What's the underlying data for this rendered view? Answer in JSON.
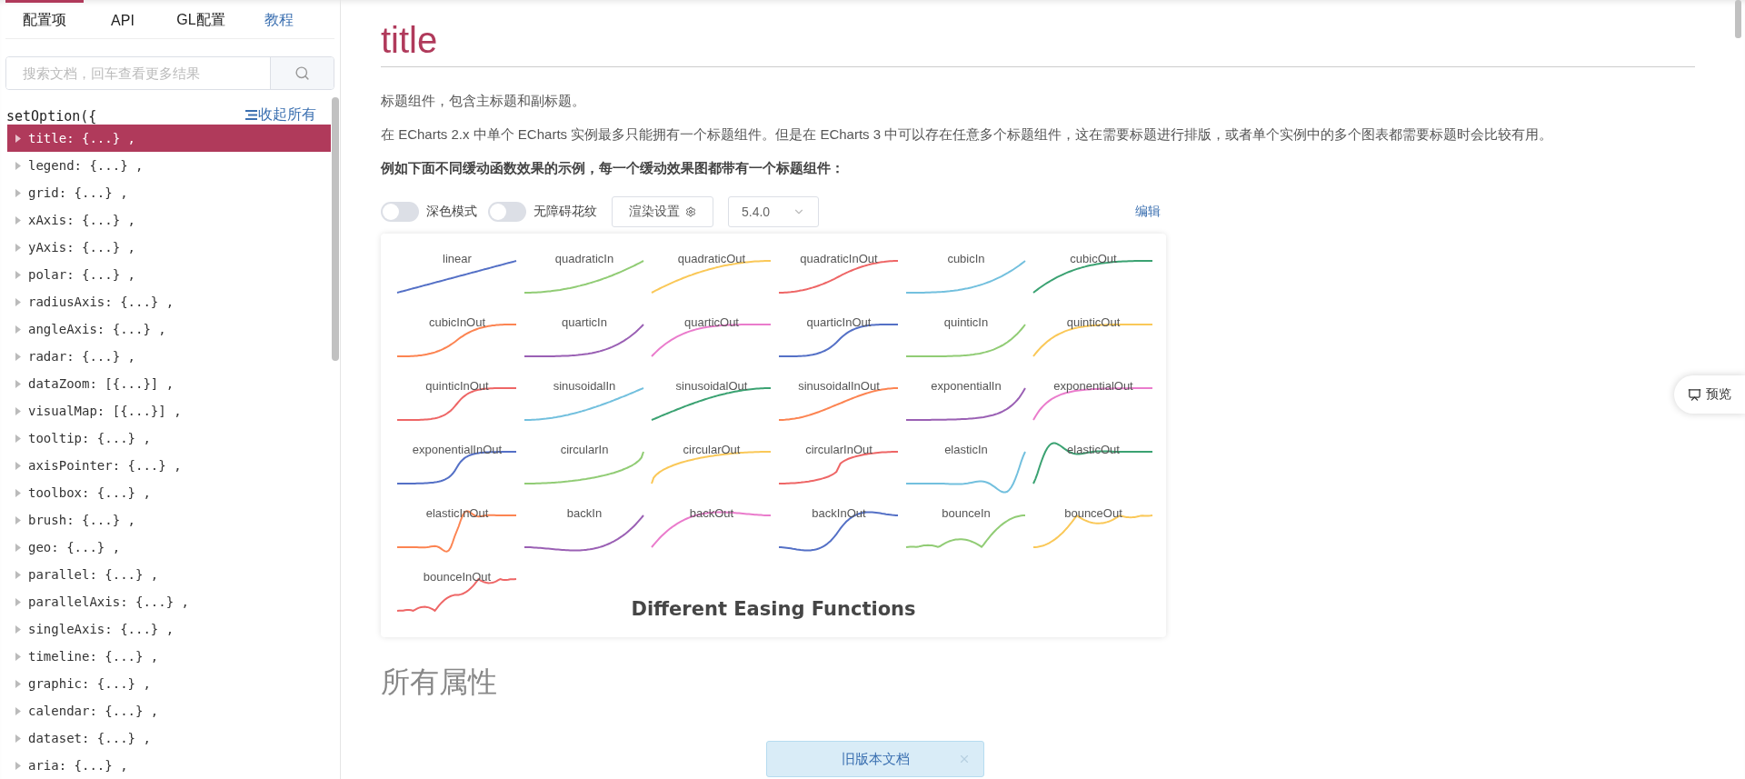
{
  "sidebar": {
    "tabs": [
      {
        "label": "配置项",
        "kind": "tab",
        "selected": true
      },
      {
        "label": "API",
        "kind": "tab",
        "selected": false
      },
      {
        "label": "GL配置",
        "kind": "tab",
        "selected": false
      },
      {
        "label": "教程",
        "kind": "link",
        "selected": false
      }
    ],
    "search": {
      "placeholder": "搜索文档，回车查看更多结果"
    },
    "tree_header": "setOption({",
    "collapse_all": "收起所有",
    "items": [
      {
        "label": "title: {...} ,",
        "selected": true
      },
      {
        "label": "legend: {...} ,",
        "selected": false
      },
      {
        "label": "grid: {...} ,",
        "selected": false
      },
      {
        "label": "xAxis: {...} ,",
        "selected": false
      },
      {
        "label": "yAxis: {...} ,",
        "selected": false
      },
      {
        "label": "polar: {...} ,",
        "selected": false
      },
      {
        "label": "radiusAxis: {...} ,",
        "selected": false
      },
      {
        "label": "angleAxis: {...} ,",
        "selected": false
      },
      {
        "label": "radar: {...} ,",
        "selected": false
      },
      {
        "label": "dataZoom: [{...}] ,",
        "selected": false
      },
      {
        "label": "visualMap: [{...}] ,",
        "selected": false
      },
      {
        "label": "tooltip: {...} ,",
        "selected": false
      },
      {
        "label": "axisPointer: {...} ,",
        "selected": false
      },
      {
        "label": "toolbox: {...} ,",
        "selected": false
      },
      {
        "label": "brush: {...} ,",
        "selected": false
      },
      {
        "label": "geo: {...} ,",
        "selected": false
      },
      {
        "label": "parallel: {...} ,",
        "selected": false
      },
      {
        "label": "parallelAxis: {...} ,",
        "selected": false
      },
      {
        "label": "singleAxis: {...} ,",
        "selected": false
      },
      {
        "label": "timeline: {...} ,",
        "selected": false
      },
      {
        "label": "graphic: {...} ,",
        "selected": false
      },
      {
        "label": "calendar: {...} ,",
        "selected": false
      },
      {
        "label": "dataset: {...} ,",
        "selected": false
      },
      {
        "label": "aria: {...} ,",
        "selected": false
      }
    ]
  },
  "main": {
    "title": "title",
    "paragraphs": [
      "标题组件，包含主标题和副标题。",
      "在 ECharts 2.x 中单个 ECharts 实例最多只能拥有一个标题组件。但是在 ECharts 3 中可以存在任意多个标题组件，这在需要标题进行排版，或者单个实例中的多个图表都需要标题时会比较有用。"
    ],
    "example_caption": "例如下面不同缓动函数效果的示例，每一个缓动效果图都带有一个标题组件：",
    "toolbar": {
      "toggles": [
        {
          "label": "深色模式",
          "on": false
        },
        {
          "label": "无障碍花纹",
          "on": false
        }
      ],
      "render_button": "渲染设置",
      "version": "5.4.0",
      "edit": "编辑"
    },
    "chart": {
      "title": "Different Easing Functions",
      "curves": [
        {
          "label": "linear",
          "kind": "linear",
          "color": "#5470c6"
        },
        {
          "label": "quadraticIn",
          "kind": "quadraticIn",
          "color": "#91cc75"
        },
        {
          "label": "quadraticOut",
          "kind": "quadraticOut",
          "color": "#fac858"
        },
        {
          "label": "quadraticInOut",
          "kind": "quadraticInOut",
          "color": "#ee6666"
        },
        {
          "label": "cubicIn",
          "kind": "cubicIn",
          "color": "#73c0de"
        },
        {
          "label": "cubicOut",
          "kind": "cubicOut",
          "color": "#3ba272"
        },
        {
          "label": "cubicInOut",
          "kind": "cubicInOut",
          "color": "#fc8452"
        },
        {
          "label": "quarticIn",
          "kind": "quarticIn",
          "color": "#9a60b4"
        },
        {
          "label": "quarticOut",
          "kind": "quarticOut",
          "color": "#ea7ccc"
        },
        {
          "label": "quarticInOut",
          "kind": "quarticInOut",
          "color": "#5470c6"
        },
        {
          "label": "quinticIn",
          "kind": "quinticIn",
          "color": "#91cc75"
        },
        {
          "label": "quinticOut",
          "kind": "quinticOut",
          "color": "#fac858"
        },
        {
          "label": "quinticInOut",
          "kind": "quinticInOut",
          "color": "#ee6666"
        },
        {
          "label": "sinusoidalIn",
          "kind": "sinusoidalIn",
          "color": "#73c0de"
        },
        {
          "label": "sinusoidalOut",
          "kind": "sinusoidalOut",
          "color": "#3ba272"
        },
        {
          "label": "sinusoidalInOut",
          "kind": "sinusoidalInOut",
          "color": "#fc8452"
        },
        {
          "label": "exponentialIn",
          "kind": "exponentialIn",
          "color": "#9a60b4"
        },
        {
          "label": "exponentialOut",
          "kind": "exponentialOut",
          "color": "#ea7ccc"
        },
        {
          "label": "exponentialInOut",
          "kind": "exponentialInOut",
          "color": "#5470c6"
        },
        {
          "label": "circularIn",
          "kind": "circularIn",
          "color": "#91cc75"
        },
        {
          "label": "circularOut",
          "kind": "circularOut",
          "color": "#fac858"
        },
        {
          "label": "circularInOut",
          "kind": "circularInOut",
          "color": "#ee6666"
        },
        {
          "label": "elasticIn",
          "kind": "elasticIn",
          "color": "#73c0de"
        },
        {
          "label": "elasticOut",
          "kind": "elasticOut",
          "color": "#3ba272"
        },
        {
          "label": "elasticInOut",
          "kind": "elasticInOut",
          "color": "#fc8452"
        },
        {
          "label": "backIn",
          "kind": "backIn",
          "color": "#9a60b4"
        },
        {
          "label": "backOut",
          "kind": "backOut",
          "color": "#ea7ccc"
        },
        {
          "label": "backInOut",
          "kind": "backInOut",
          "color": "#5470c6"
        },
        {
          "label": "bounceIn",
          "kind": "bounceIn",
          "color": "#91cc75"
        },
        {
          "label": "bounceOut",
          "kind": "bounceOut",
          "color": "#fac858"
        },
        {
          "label": "bounceInOut",
          "kind": "bounceInOut",
          "color": "#ee6666"
        }
      ]
    },
    "section_heading": "所有属性"
  },
  "preview_button": "预览",
  "toast": {
    "text": "旧版本文档"
  }
}
